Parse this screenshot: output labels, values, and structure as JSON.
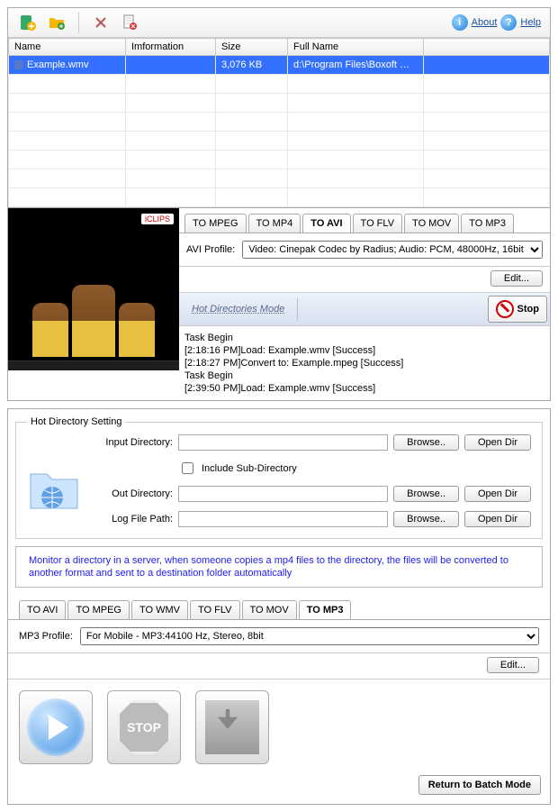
{
  "top": {
    "toolbar": {
      "about": "About",
      "help": "Help"
    },
    "columns": [
      "Name",
      "Imformation",
      "Size",
      "Full Name",
      ""
    ],
    "rows": [
      {
        "name": "Example.wmv",
        "info": "",
        "size": "3,076 KB",
        "full": "d:\\Program Files\\Boxoft WMV Conve...",
        "selected": true
      }
    ],
    "tabs": [
      "TO MPEG",
      "TO MP4",
      "TO AVI",
      "TO FLV",
      "TO MOV",
      "TO MP3"
    ],
    "active_tab": 2,
    "profile_label": "AVI Profile:",
    "profile_value": "Video: Cinepak Codec by Radius; Audio: PCM, 48000Hz, 16bit",
    "edit": "Edit...",
    "mode": "Hot Directories Mode",
    "stop": "Stop",
    "log": "Task Begin\n[2:18:16 PM]Load: Example.wmv [Success]\n[2:18:27 PM]Convert to: Example.mpeg [Success]\nTask Begin\n[2:39:50 PM]Load: Example.wmv [Success]"
  },
  "bottom": {
    "legend": "Hot Directory Setting",
    "input_label": "Input Directory:",
    "include_sub": "Include Sub-Directory",
    "out_label": "Out Directory:",
    "log_label": "Log File Path:",
    "browse": "Browse..",
    "open_dir": "Open Dir",
    "note": "Monitor a directory in a server, when someone copies a mp4 files to the directory, the files will be converted to another format and sent to a destination folder automatically",
    "tabs": [
      "TO AVI",
      "TO MPEG",
      "TO WMV",
      "TO FLV",
      "TO MOV",
      "TO MP3"
    ],
    "active_tab": 5,
    "profile_label": "MP3 Profile:",
    "profile_value": "For Mobile - MP3:44100 Hz, Stereo, 8bit",
    "edit": "Edit...",
    "stop_label": "STOP",
    "return": "Return to Batch Mode"
  }
}
